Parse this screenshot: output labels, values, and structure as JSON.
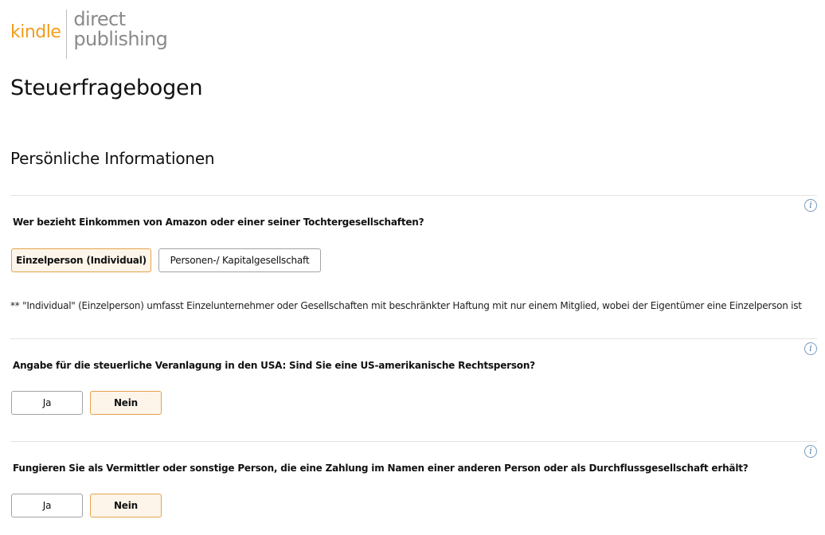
{
  "logo": {
    "kindle": "kindle",
    "direct": "direct",
    "publishing": "publishing"
  },
  "page_title": "Steuerfragebogen",
  "section_title": "Persönliche Informationen",
  "info_icon_glyph": "i",
  "questions": [
    {
      "text": "Wer bezieht Einkommen von Amazon oder einer seiner Tochtergesellschaften?",
      "options": [
        {
          "label": "Einzelperson (Individual)",
          "selected": true
        },
        {
          "label": "Personen-/ Kapitalgesellschaft",
          "selected": false
        }
      ],
      "note": "** \"Individual\" (Einzelperson) umfasst Einzelunternehmer oder Gesellschaften mit beschränkter Haftung mit nur einem Mitglied, wobei der Eigentümer eine Einzelperson ist"
    },
    {
      "text": "Angabe für die steuerliche Veranlagung in den USA: Sind Sie eine US-amerikanische Rechtsperson?",
      "options": [
        {
          "label": "Ja",
          "selected": false
        },
        {
          "label": "Nein",
          "selected": true
        }
      ]
    },
    {
      "text": "Fungieren Sie als Vermittler oder sonstige Person, die eine Zahlung im Namen einer anderen Person oder als Durchflussgesellschaft erhält?",
      "options": [
        {
          "label": "Ja",
          "selected": false
        },
        {
          "label": "Nein",
          "selected": true
        }
      ]
    }
  ],
  "colors": {
    "brand_orange": "#f39c19",
    "selected_border": "#e3a34b",
    "selected_background": "#fdf5ea",
    "info_icon": "#4d7eae"
  }
}
